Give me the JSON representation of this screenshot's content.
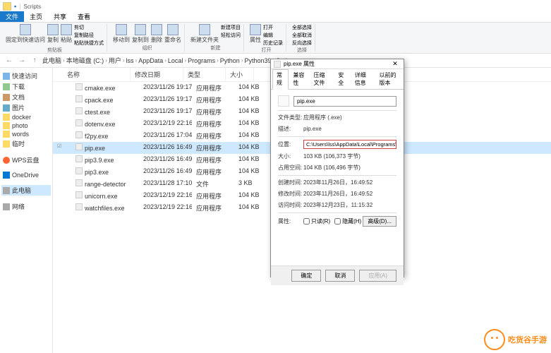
{
  "window": {
    "title": "Scripts"
  },
  "tabs": {
    "file": "文件",
    "home": "主页",
    "share": "共享",
    "view": "查看"
  },
  "ribbon": {
    "pin": "固定到快速访问",
    "copy": "复制",
    "paste": "粘贴",
    "copypath": "复制路径",
    "pasteshortcut": "粘贴快捷方式",
    "cut": "剪切",
    "move": "移动到",
    "copyto": "复制到",
    "delete": "删除",
    "rename": "重命名",
    "newfolder": "新建文件夹",
    "newitem": "新建项目",
    "easyaccess": "轻松访问",
    "properties": "属性",
    "open": "打开",
    "edit": "编辑",
    "history": "历史记录",
    "selectall": "全部选择",
    "selectnone": "全部取消",
    "invert": "反向选择",
    "g_clip": "剪贴板",
    "g_org": "组织",
    "g_new": "新建",
    "g_open": "打开",
    "g_sel": "选择"
  },
  "breadcrumb": [
    "此电脑",
    "本地磁盘 (C:)",
    "用户",
    "lss",
    "AppData",
    "Local",
    "Programs",
    "Python",
    "Python39",
    "Scripts"
  ],
  "nav": {
    "quick": "快速访问",
    "downloads": "下载",
    "documents": "文档",
    "pictures": "图片",
    "docker": "docker",
    "photo": "photo",
    "words": "words",
    "temp": "临时",
    "wps": "WPS云盘",
    "onedrive": "OneDrive",
    "thispc": "此电脑",
    "network": "网络"
  },
  "columns": {
    "name": "名称",
    "date": "修改日期",
    "type": "类型",
    "size": "大小"
  },
  "files": [
    {
      "name": "cmake.exe",
      "date": "2023/11/26 19:17",
      "type": "应用程序",
      "size": "104 KB"
    },
    {
      "name": "cpack.exe",
      "date": "2023/11/26 19:17",
      "type": "应用程序",
      "size": "104 KB"
    },
    {
      "name": "ctest.exe",
      "date": "2023/11/26 19:17",
      "type": "应用程序",
      "size": "104 KB"
    },
    {
      "name": "dotenv.exe",
      "date": "2023/12/19 22:16",
      "type": "应用程序",
      "size": "104 KB"
    },
    {
      "name": "f2py.exe",
      "date": "2023/11/26 17:04",
      "type": "应用程序",
      "size": "104 KB"
    },
    {
      "name": "pip.exe",
      "date": "2023/11/26 16:49",
      "type": "应用程序",
      "size": "104 KB",
      "sel": true
    },
    {
      "name": "pip3.9.exe",
      "date": "2023/11/26 16:49",
      "type": "应用程序",
      "size": "104 KB"
    },
    {
      "name": "pip3.exe",
      "date": "2023/11/26 16:49",
      "type": "应用程序",
      "size": "104 KB"
    },
    {
      "name": "range-detector",
      "date": "2023/11/28 17:10",
      "type": "文件",
      "size": "3 KB"
    },
    {
      "name": "unicorn.exe",
      "date": "2023/12/19 22:16",
      "type": "应用程序",
      "size": "104 KB"
    },
    {
      "name": "watchfiles.exe",
      "date": "2023/12/19 22:16",
      "type": "应用程序",
      "size": "104 KB"
    }
  ],
  "dialog": {
    "title": "pip.exe 属性",
    "tabs": {
      "general": "常规",
      "compat": "兼容性",
      "compress": "压缩文件",
      "security": "安全",
      "details": "详细信息",
      "prev": "以前的版本"
    },
    "filename": "pip.exe",
    "filetype_lbl": "文件类型:",
    "filetype": "应用程序 (.exe)",
    "desc_lbl": "描述:",
    "desc": "pip.exe",
    "loc_lbl": "位置:",
    "loc": "C:\\Users\\lss\\AppData\\Local\\Programs\\Python\\Pyt",
    "size_lbl": "大小:",
    "size": "103 KB (106,373 字节)",
    "ondisk_lbl": "占用空间:",
    "ondisk": "104 KB (106,496 字节)",
    "created_lbl": "创建时间:",
    "created": "2023年11月26日，16:49:52",
    "modified_lbl": "修改时间:",
    "modified": "2023年11月26日，16:49:52",
    "accessed_lbl": "访问时间:",
    "accessed": "2023年12月23日，11:15:32",
    "attr_lbl": "属性:",
    "readonly": "只读(R)",
    "hidden": "隐藏(H)",
    "advanced": "高级(D)...",
    "ok": "确定",
    "cancel": "取消",
    "apply": "应用(A)"
  },
  "watermark": "吃货谷手游"
}
